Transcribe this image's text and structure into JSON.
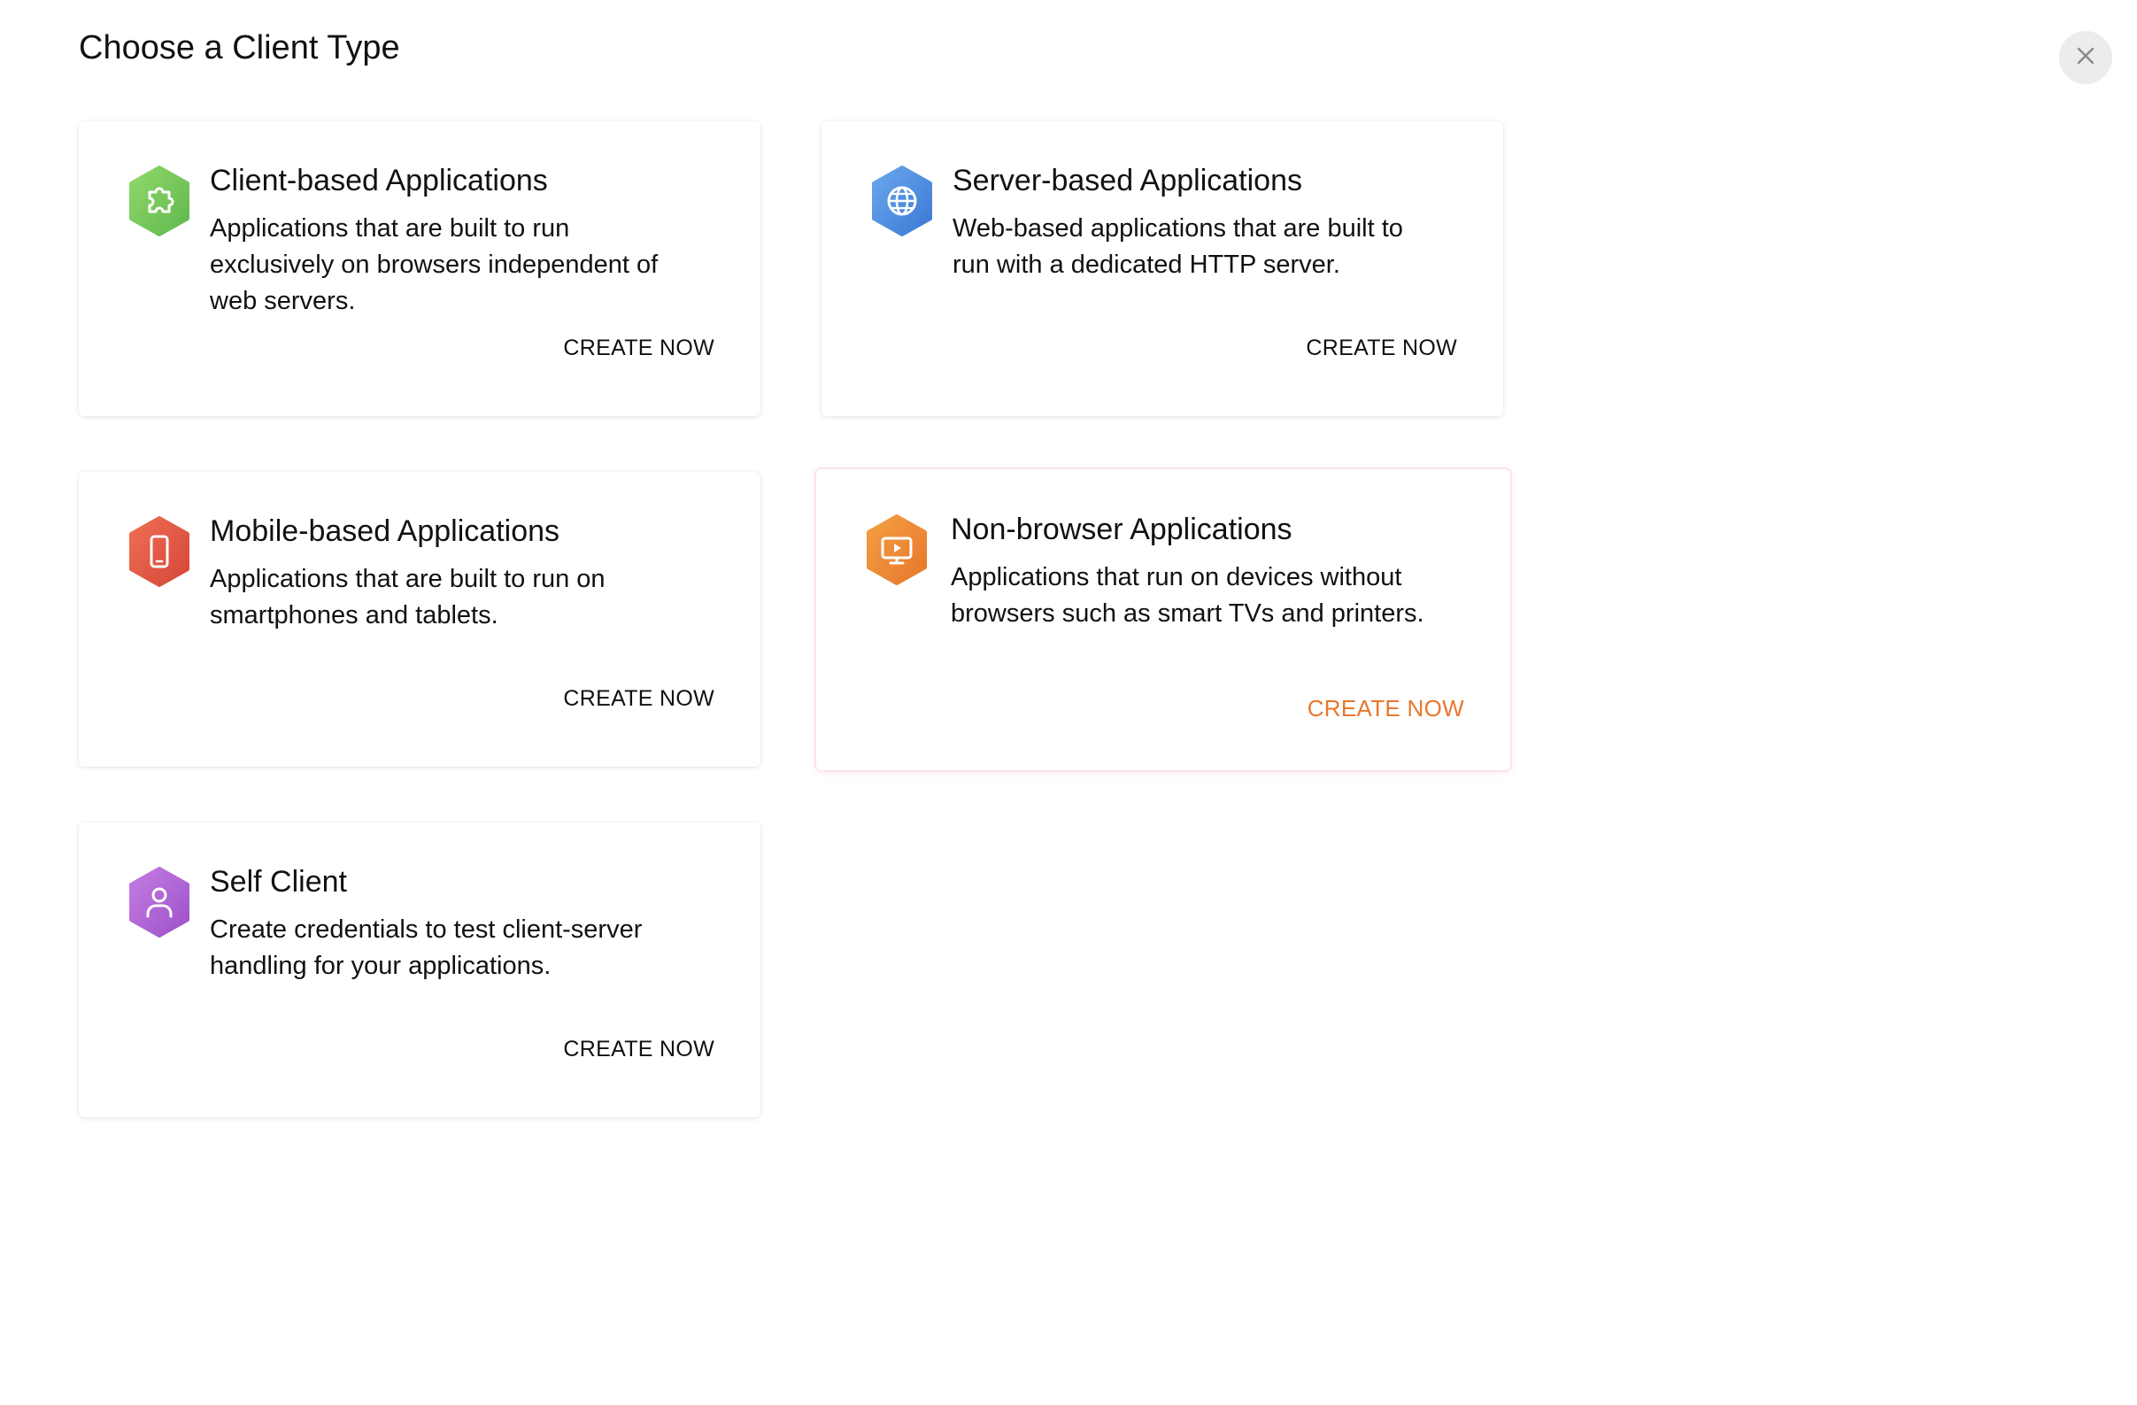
{
  "header": {
    "title": "Choose a Client Type",
    "close_icon": "close-icon"
  },
  "colors": {
    "accent_orange": "#e8772e",
    "card_active_border": "#fde3ea",
    "green_icon": "#7dc95e",
    "blue_icon": "#4f8fe0",
    "red_icon": "#e05a48",
    "orange_icon": "#ee8a36",
    "purple_icon": "#b066d6"
  },
  "cards": [
    {
      "icon": "puzzle-icon",
      "title": "Client-based Applications",
      "description": "Applications that are built to run exclusively on browsers independent of web servers.",
      "action": "CREATE NOW"
    },
    {
      "icon": "globe-icon",
      "title": "Server-based Applications",
      "description": "Web-based applications that are built to run with a dedicated HTTP server.",
      "action": "CREATE NOW"
    },
    {
      "icon": "smartphone-icon",
      "title": "Mobile-based Applications",
      "description": "Applications that are built to run on smartphones and tablets.",
      "action": "CREATE NOW"
    },
    {
      "icon": "monitor-play-icon",
      "title": "Non-browser Applications",
      "description": "Applications that run on devices without browsers such as smart TVs and printers.",
      "action": "CREATE NOW",
      "selected": true
    },
    {
      "icon": "user-icon",
      "title": "Self Client",
      "description": "Create credentials to test client-server handling for your applications.",
      "action": "CREATE NOW"
    }
  ]
}
